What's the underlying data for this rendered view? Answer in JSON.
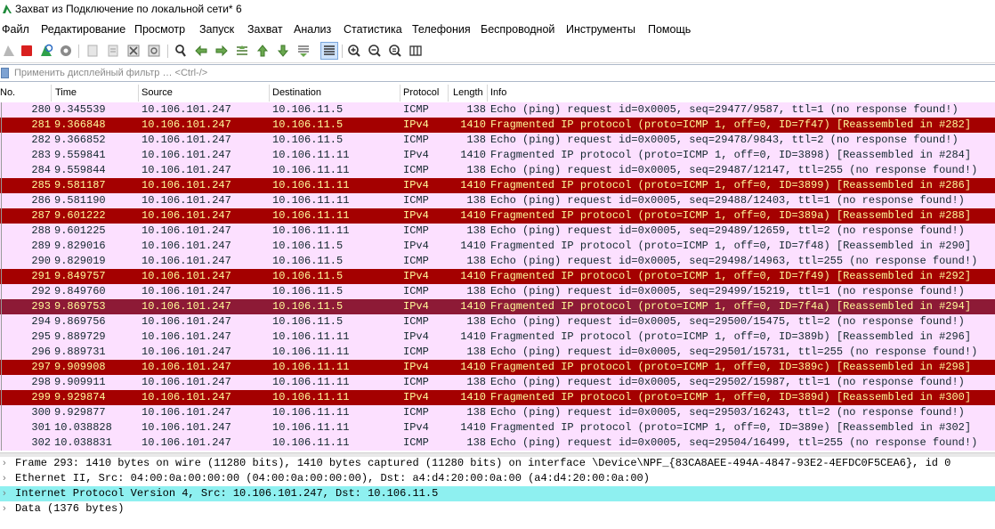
{
  "window": {
    "title": "Захват из Подключение по локальной сети* 6",
    "icon": "wireshark-fin-icon"
  },
  "colors": {
    "icmp_bg": "#fce0ff",
    "frag_bg": "#a40000",
    "frag_fg": "#fffc9c",
    "selected_bg": "#8d1a36",
    "selected_fg": "#fffc9c",
    "details_highlight": "#8ef0f0",
    "text": "#12272e"
  },
  "menu": [
    "Файл",
    "Редактирование",
    "Просмотр",
    "Запуск",
    "Захват",
    "Анализ",
    "Статистика",
    "Телефония",
    "Беспроводной",
    "Инструменты",
    "Помощь"
  ],
  "toolbar": {
    "icons": [
      "start-capture-icon",
      "stop-capture-icon",
      "restart-capture-icon",
      "capture-options-icon",
      "open-file-icon",
      "save-file-icon",
      "close-file-icon",
      "reload-file-icon",
      "find-packet-icon",
      "go-back-icon",
      "go-forward-icon",
      "go-to-packet-icon",
      "go-first-icon",
      "go-last-icon",
      "autoscroll-icon",
      "colorize-icon",
      "zoom-in-icon",
      "zoom-out-icon",
      "normal-size-icon",
      "resize-columns-icon"
    ]
  },
  "filter": {
    "placeholder": "Применить дисплейный фильтр … <Ctrl-/>"
  },
  "columns": [
    "No.",
    "Time",
    "Source",
    "Destination",
    "Protocol",
    "Length",
    "Info"
  ],
  "packets": [
    {
      "no": "280",
      "time": "9.345539",
      "src": "10.106.101.247",
      "dst": "10.106.11.5",
      "proto": "ICMP",
      "len": "138",
      "info": "Echo (ping) request  id=0x0005, seq=29477/9587, ttl=1 (no response found!)",
      "style": "icmp"
    },
    {
      "no": "281",
      "time": "9.366848",
      "src": "10.106.101.247",
      "dst": "10.106.11.5",
      "proto": "IPv4",
      "len": "1410",
      "info": "Fragmented IP protocol (proto=ICMP 1, off=0, ID=7f47) [Reassembled in #282]",
      "style": "frag"
    },
    {
      "no": "282",
      "time": "9.366852",
      "src": "10.106.101.247",
      "dst": "10.106.11.5",
      "proto": "ICMP",
      "len": "138",
      "info": "Echo (ping) request  id=0x0005, seq=29478/9843, ttl=2 (no response found!)",
      "style": "icmp"
    },
    {
      "no": "283",
      "time": "9.559841",
      "src": "10.106.101.247",
      "dst": "10.106.11.11",
      "proto": "IPv4",
      "len": "1410",
      "info": "Fragmented IP protocol (proto=ICMP 1, off=0, ID=3898) [Reassembled in #284]",
      "style": "icmp"
    },
    {
      "no": "284",
      "time": "9.559844",
      "src": "10.106.101.247",
      "dst": "10.106.11.11",
      "proto": "ICMP",
      "len": "138",
      "info": "Echo (ping) request  id=0x0005, seq=29487/12147, ttl=255 (no response found!)",
      "style": "icmp"
    },
    {
      "no": "285",
      "time": "9.581187",
      "src": "10.106.101.247",
      "dst": "10.106.11.11",
      "proto": "IPv4",
      "len": "1410",
      "info": "Fragmented IP protocol (proto=ICMP 1, off=0, ID=3899) [Reassembled in #286]",
      "style": "frag"
    },
    {
      "no": "286",
      "time": "9.581190",
      "src": "10.106.101.247",
      "dst": "10.106.11.11",
      "proto": "ICMP",
      "len": "138",
      "info": "Echo (ping) request  id=0x0005, seq=29488/12403, ttl=1 (no response found!)",
      "style": "icmp"
    },
    {
      "no": "287",
      "time": "9.601222",
      "src": "10.106.101.247",
      "dst": "10.106.11.11",
      "proto": "IPv4",
      "len": "1410",
      "info": "Fragmented IP protocol (proto=ICMP 1, off=0, ID=389a) [Reassembled in #288]",
      "style": "frag"
    },
    {
      "no": "288",
      "time": "9.601225",
      "src": "10.106.101.247",
      "dst": "10.106.11.11",
      "proto": "ICMP",
      "len": "138",
      "info": "Echo (ping) request  id=0x0005, seq=29489/12659, ttl=2 (no response found!)",
      "style": "icmp"
    },
    {
      "no": "289",
      "time": "9.829016",
      "src": "10.106.101.247",
      "dst": "10.106.11.5",
      "proto": "IPv4",
      "len": "1410",
      "info": "Fragmented IP protocol (proto=ICMP 1, off=0, ID=7f48) [Reassembled in #290]",
      "style": "icmp"
    },
    {
      "no": "290",
      "time": "9.829019",
      "src": "10.106.101.247",
      "dst": "10.106.11.5",
      "proto": "ICMP",
      "len": "138",
      "info": "Echo (ping) request  id=0x0005, seq=29498/14963, ttl=255 (no response found!)",
      "style": "icmp"
    },
    {
      "no": "291",
      "time": "9.849757",
      "src": "10.106.101.247",
      "dst": "10.106.11.5",
      "proto": "IPv4",
      "len": "1410",
      "info": "Fragmented IP protocol (proto=ICMP 1, off=0, ID=7f49) [Reassembled in #292]",
      "style": "frag"
    },
    {
      "no": "292",
      "time": "9.849760",
      "src": "10.106.101.247",
      "dst": "10.106.11.5",
      "proto": "ICMP",
      "len": "138",
      "info": "Echo (ping) request  id=0x0005, seq=29499/15219, ttl=1 (no response found!)",
      "style": "icmp"
    },
    {
      "no": "293",
      "time": "9.869753",
      "src": "10.106.101.247",
      "dst": "10.106.11.5",
      "proto": "IPv4",
      "len": "1410",
      "info": "Fragmented IP protocol (proto=ICMP 1, off=0, ID=7f4a) [Reassembled in #294]",
      "style": "selected"
    },
    {
      "no": "294",
      "time": "9.869756",
      "src": "10.106.101.247",
      "dst": "10.106.11.5",
      "proto": "ICMP",
      "len": "138",
      "info": "Echo (ping) request  id=0x0005, seq=29500/15475, ttl=2 (no response found!)",
      "style": "icmp"
    },
    {
      "no": "295",
      "time": "9.889729",
      "src": "10.106.101.247",
      "dst": "10.106.11.11",
      "proto": "IPv4",
      "len": "1410",
      "info": "Fragmented IP protocol (proto=ICMP 1, off=0, ID=389b) [Reassembled in #296]",
      "style": "icmp"
    },
    {
      "no": "296",
      "time": "9.889731",
      "src": "10.106.101.247",
      "dst": "10.106.11.11",
      "proto": "ICMP",
      "len": "138",
      "info": "Echo (ping) request  id=0x0005, seq=29501/15731, ttl=255 (no response found!)",
      "style": "icmp"
    },
    {
      "no": "297",
      "time": "9.909908",
      "src": "10.106.101.247",
      "dst": "10.106.11.11",
      "proto": "IPv4",
      "len": "1410",
      "info": "Fragmented IP protocol (proto=ICMP 1, off=0, ID=389c) [Reassembled in #298]",
      "style": "frag"
    },
    {
      "no": "298",
      "time": "9.909911",
      "src": "10.106.101.247",
      "dst": "10.106.11.11",
      "proto": "ICMP",
      "len": "138",
      "info": "Echo (ping) request  id=0x0005, seq=29502/15987, ttl=1 (no response found!)",
      "style": "icmp"
    },
    {
      "no": "299",
      "time": "9.929874",
      "src": "10.106.101.247",
      "dst": "10.106.11.11",
      "proto": "IPv4",
      "len": "1410",
      "info": "Fragmented IP protocol (proto=ICMP 1, off=0, ID=389d) [Reassembled in #300]",
      "style": "frag"
    },
    {
      "no": "300",
      "time": "9.929877",
      "src": "10.106.101.247",
      "dst": "10.106.11.11",
      "proto": "ICMP",
      "len": "138",
      "info": "Echo (ping) request  id=0x0005, seq=29503/16243, ttl=2 (no response found!)",
      "style": "icmp"
    },
    {
      "no": "301",
      "time": "10.038828",
      "src": "10.106.101.247",
      "dst": "10.106.11.11",
      "proto": "IPv4",
      "len": "1410",
      "info": "Fragmented IP protocol (proto=ICMP 1, off=0, ID=389e) [Reassembled in #302]",
      "style": "icmp"
    },
    {
      "no": "302",
      "time": "10.038831",
      "src": "10.106.101.247",
      "dst": "10.106.11.11",
      "proto": "ICMP",
      "len": "138",
      "info": "Echo (ping) request  id=0x0005, seq=29504/16499, ttl=255 (no response found!)",
      "style": "icmp"
    }
  ],
  "details": [
    {
      "text": "Frame 293: 1410 bytes on wire (11280 bits), 1410 bytes captured (11280 bits) on interface \\Device\\NPF_{83CA8AEE-494A-4847-93E2-4EFDC0F5CEA6}, id 0",
      "highlight": false
    },
    {
      "text": "Ethernet II, Src: 04:00:0a:00:00:00 (04:00:0a:00:00:00), Dst: a4:d4:20:00:0a:00 (a4:d4:20:00:0a:00)",
      "highlight": false
    },
    {
      "text": "Internet Protocol Version 4, Src: 10.106.101.247, Dst: 10.106.11.5",
      "highlight": true
    },
    {
      "text": "Data (1376 bytes)",
      "highlight": false
    }
  ]
}
